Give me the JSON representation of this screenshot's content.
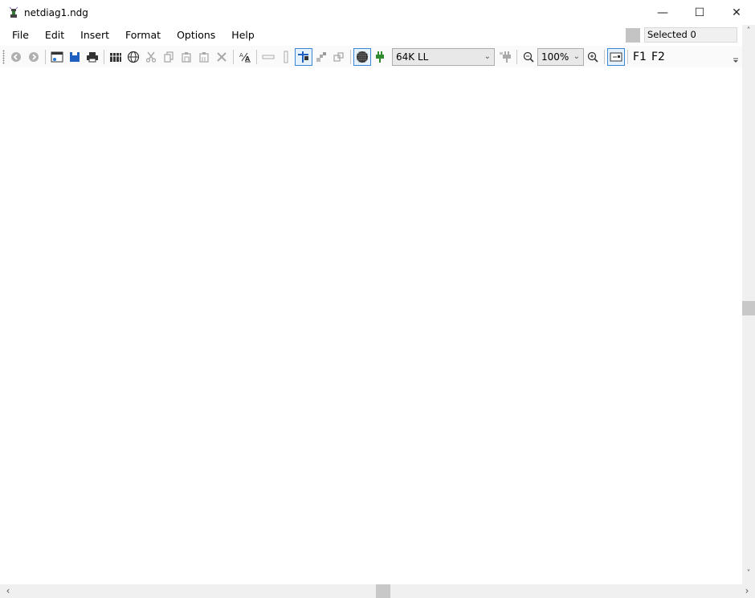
{
  "window": {
    "title": "netdiag1.ndg",
    "controls": {
      "minimize": "—",
      "maximize": "☐",
      "close": "✕"
    }
  },
  "menu": {
    "items": [
      {
        "label": "File"
      },
      {
        "label": "Edit"
      },
      {
        "label": "Insert"
      },
      {
        "label": "Format"
      },
      {
        "label": "Options"
      },
      {
        "label": "Help"
      }
    ]
  },
  "selection": {
    "label": "Selected 0"
  },
  "toolbar": {
    "line_speed": {
      "value": "64K LL"
    },
    "zoom": {
      "value": "100%"
    },
    "function_keys": [
      "F1",
      "F2"
    ],
    "icons": [
      "back-icon",
      "forward-icon",
      "new-window-icon",
      "save-icon",
      "print-icon",
      "library-icon",
      "globe-icon",
      "cut-icon",
      "copy-icon",
      "paste-icon",
      "paste-special-icon",
      "delete-icon",
      "text-format-icon",
      "horizontal-line-icon",
      "vertical-line-icon",
      "connect-tool-icon",
      "bring-front-icon",
      "send-back-icon",
      "grid-icon",
      "plug-icon",
      "unplug-icon",
      "zoom-out-icon",
      "zoom-in-icon",
      "display-icon"
    ]
  },
  "scrollbars": {
    "vertical": {
      "up": "˄",
      "down": "˅",
      "position": 0.5
    },
    "horizontal": {
      "left": "‹",
      "right": "›",
      "position": 0.5
    }
  },
  "colors": {
    "accent": "#3a87d9",
    "save": "#1e5fbf",
    "plug": "#2e8b2e"
  }
}
